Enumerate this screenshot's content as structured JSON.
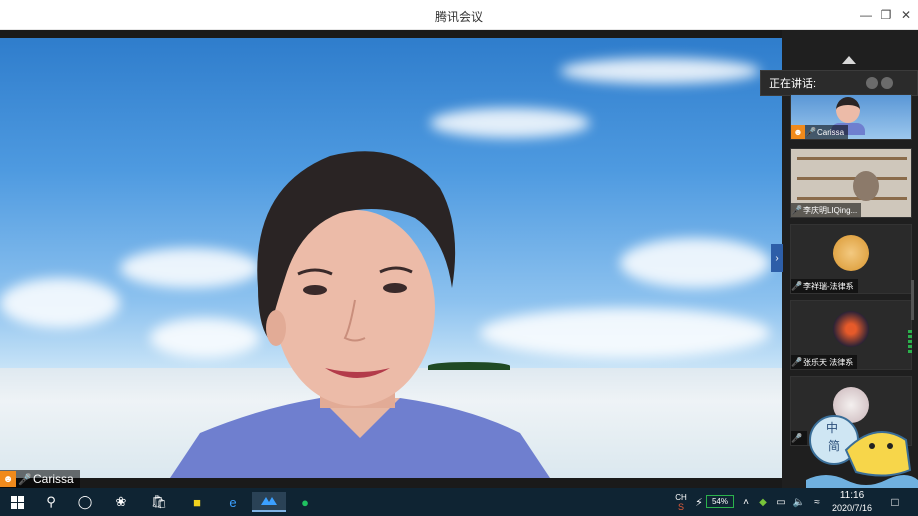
{
  "window": {
    "title": "腾讯会议",
    "minimize_icon": "minimize-icon",
    "maximize_icon": "restore-icon",
    "close_icon": "close-icon"
  },
  "main_video": {
    "speaker_name": "Carissa"
  },
  "panel": {
    "speaking_label": "正在讲话:",
    "participants": [
      {
        "name": "Carissa",
        "has_avatar_badge": true
      },
      {
        "name": "李庆明LIQing...",
        "has_avatar_badge": false
      },
      {
        "name": "李祥瑞-法律系",
        "has_avatar_badge": false
      },
      {
        "name": "张乐天 法律系",
        "has_avatar_badge": false
      },
      {
        "name": "",
        "has_avatar_badge": false
      }
    ]
  },
  "taskbar": {
    "lang_top": "CH",
    "battery_percent": "54%",
    "time": "11:16",
    "date": "2020/7/16"
  },
  "colors": {
    "accent_orange": "#f08a1c",
    "taskbar_bg": "#0f2433",
    "battery_green": "#2bb24c"
  }
}
